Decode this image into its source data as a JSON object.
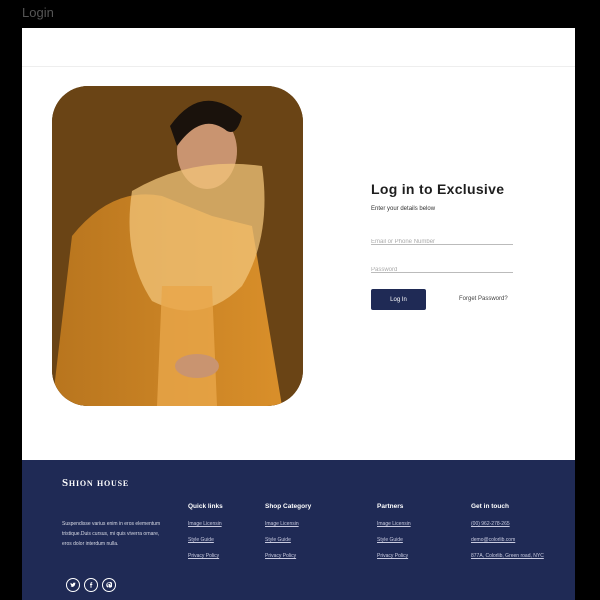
{
  "window": {
    "title": "Login"
  },
  "login": {
    "title": "Log in to Exclusive",
    "subtitle": "Enter your details below",
    "email_placeholder": "Email or Phone Number",
    "password_placeholder": "Password",
    "login_button": "Log In",
    "forgot_link": "Forget Password?"
  },
  "footer": {
    "brand": "Shion house",
    "description": [
      "Suspendisse varius enim in eros elementum",
      "tristique.Duis cursus, mi quis viverra ornare,",
      "eros dolor interdum nulla."
    ],
    "socials": [
      "twitter-icon",
      "facebook-icon",
      "pinterest-icon"
    ],
    "columns": [
      {
        "title": "Quick links",
        "links": [
          "Image Licensin",
          "Style Guide",
          "Privacy Policy"
        ]
      },
      {
        "title": "Shop Category",
        "links": [
          "Image Licensin",
          "Style Guide",
          "Privacy Policy"
        ]
      },
      {
        "title": "Partners",
        "links": [
          "Image Licensin",
          "Style Guide",
          "Privacy Policy"
        ]
      },
      {
        "title": "Get in touch",
        "links": [
          "(00) 962-278-265",
          "demo@colorlib.com",
          "877A, Colorlib, Green road, NYC"
        ]
      }
    ]
  },
  "colors": {
    "footer_bg": "#1f2a55",
    "button_bg": "#1f2a55",
    "page_bg": "#ffffff"
  }
}
